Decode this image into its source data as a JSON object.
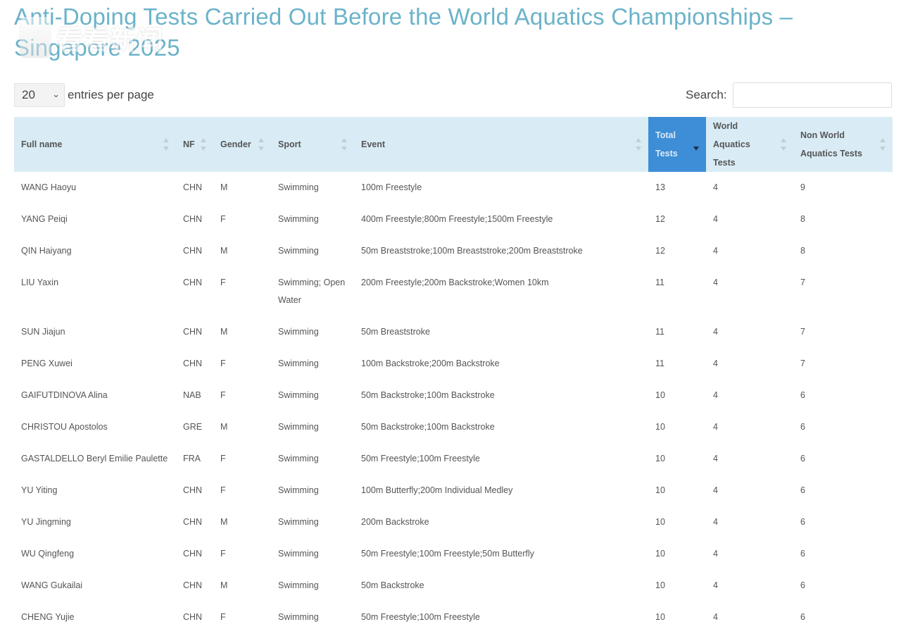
{
  "page": {
    "title": "Anti-Doping Tests Carried Out Before the World Aquatics Championships – Singapore 2025",
    "watermark_text": "看看新闻"
  },
  "controls": {
    "length_value": "20",
    "length_label": "entries per page",
    "search_label": "Search:",
    "search_value": ""
  },
  "table": {
    "columns": [
      {
        "key": "full_name",
        "label": "Full name"
      },
      {
        "key": "nf",
        "label": "NF"
      },
      {
        "key": "gender",
        "label": "Gender"
      },
      {
        "key": "sport",
        "label": "Sport"
      },
      {
        "key": "event",
        "label": "Event"
      },
      {
        "key": "total_tests",
        "label": "Total Tests",
        "sorted": "desc"
      },
      {
        "key": "world_aquatics_tests",
        "label": "World Aquatics Tests"
      },
      {
        "key": "non_world_aquatics_tests",
        "label": "Non World Aquatics Tests"
      }
    ],
    "rows": [
      [
        "WANG Haoyu",
        "CHN",
        "M",
        "Swimming",
        "100m Freestyle",
        "13",
        "4",
        "9"
      ],
      [
        "YANG Peiqi",
        "CHN",
        "F",
        "Swimming",
        "400m Freestyle;800m Freestyle;1500m Freestyle",
        "12",
        "4",
        "8"
      ],
      [
        "QIN Haiyang",
        "CHN",
        "M",
        "Swimming",
        "50m Breaststroke;100m Breaststroke;200m Breaststroke",
        "12",
        "4",
        "8"
      ],
      [
        "LIU Yaxin",
        "CHN",
        "F",
        "Swimming; Open Water",
        "200m Freestyle;200m Backstroke;Women 10km",
        "11",
        "4",
        "7"
      ],
      [
        "SUN Jiajun",
        "CHN",
        "M",
        "Swimming",
        "50m Breaststroke",
        "11",
        "4",
        "7"
      ],
      [
        "PENG Xuwei",
        "CHN",
        "F",
        "Swimming",
        "100m Backstroke;200m Backstroke",
        "11",
        "4",
        "7"
      ],
      [
        "GAIFUTDINOVA Alina",
        "NAB",
        "F",
        "Swimming",
        "50m Backstroke;100m Backstroke",
        "10",
        "4",
        "6"
      ],
      [
        "CHRISTOU Apostolos",
        "GRE",
        "M",
        "Swimming",
        "50m Backstroke;100m Backstroke",
        "10",
        "4",
        "6"
      ],
      [
        "GASTALDELLO Beryl Emilie Paulette",
        "FRA",
        "F",
        "Swimming",
        "50m Freestyle;100m Freestyle",
        "10",
        "4",
        "6"
      ],
      [
        "YU Yiting",
        "CHN",
        "F",
        "Swimming",
        "100m Butterfly;200m Individual Medley",
        "10",
        "4",
        "6"
      ],
      [
        "YU Jingming",
        "CHN",
        "M",
        "Swimming",
        "200m Backstroke",
        "10",
        "4",
        "6"
      ],
      [
        "WU Qingfeng",
        "CHN",
        "F",
        "Swimming",
        "50m Freestyle;100m Freestyle;50m Butterfly",
        "10",
        "4",
        "6"
      ],
      [
        "WANG Gukailai",
        "CHN",
        "M",
        "Swimming",
        "50m Backstroke",
        "10",
        "4",
        "6"
      ],
      [
        "CHENG Yujie",
        "CHN",
        "F",
        "Swimming",
        "50m Freestyle;100m Freestyle",
        "10",
        "4",
        "6"
      ]
    ]
  }
}
